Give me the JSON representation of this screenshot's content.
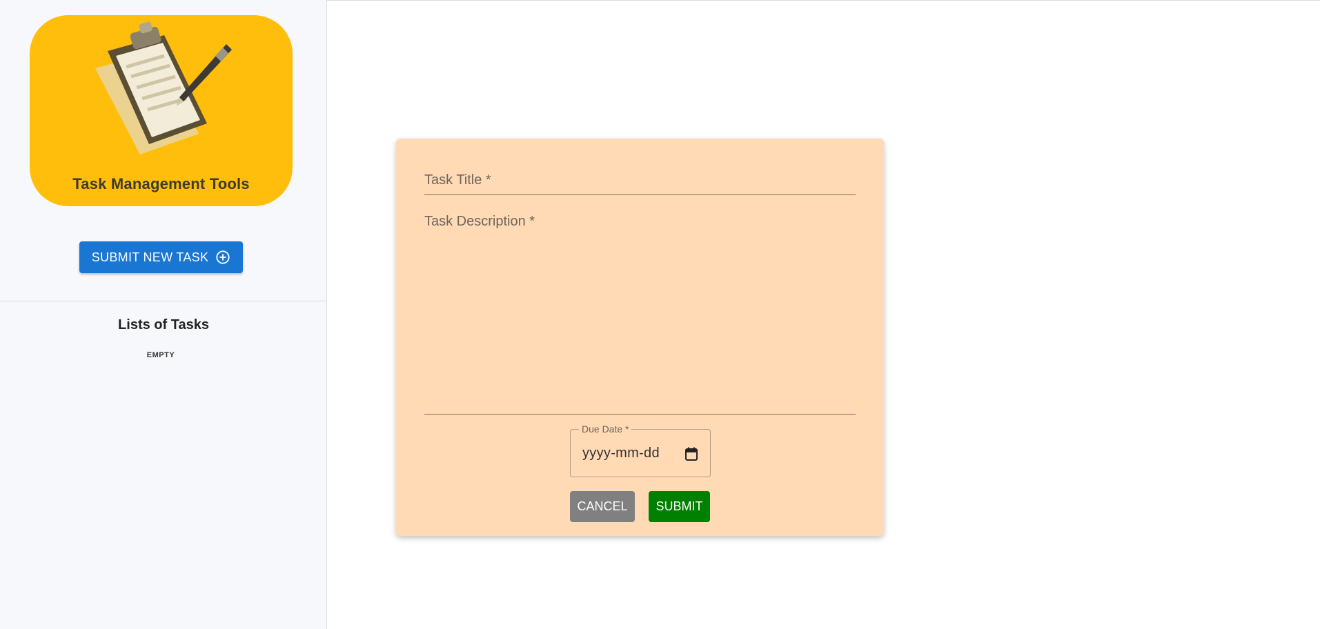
{
  "sidebar": {
    "logo_title": "Task Management Tools",
    "logo_icon": "clipboard-pen-icon",
    "submit_new_task_label": "SUBMIT NEW TASK",
    "submit_new_task_icon": "add-circle-icon",
    "lists_title": "Lists of Tasks",
    "empty_label": "EMPTY"
  },
  "form": {
    "title_label": "Task Title *",
    "title_value": "",
    "description_label": "Task Description *",
    "description_value": "",
    "due_date_label": "Due Date *",
    "due_date_placeholder": "yyyy-mm-dd",
    "calendar_icon": "calendar-icon",
    "cancel_label": "CANCEL",
    "submit_label": "SUBMIT"
  },
  "colors": {
    "logo_background": "#ffbe0b",
    "primary_button": "#1976d2",
    "form_background": "#ffdab5",
    "cancel_button": "#808080",
    "submit_button": "#008000",
    "sidebar_background": "#f7f8fc"
  }
}
